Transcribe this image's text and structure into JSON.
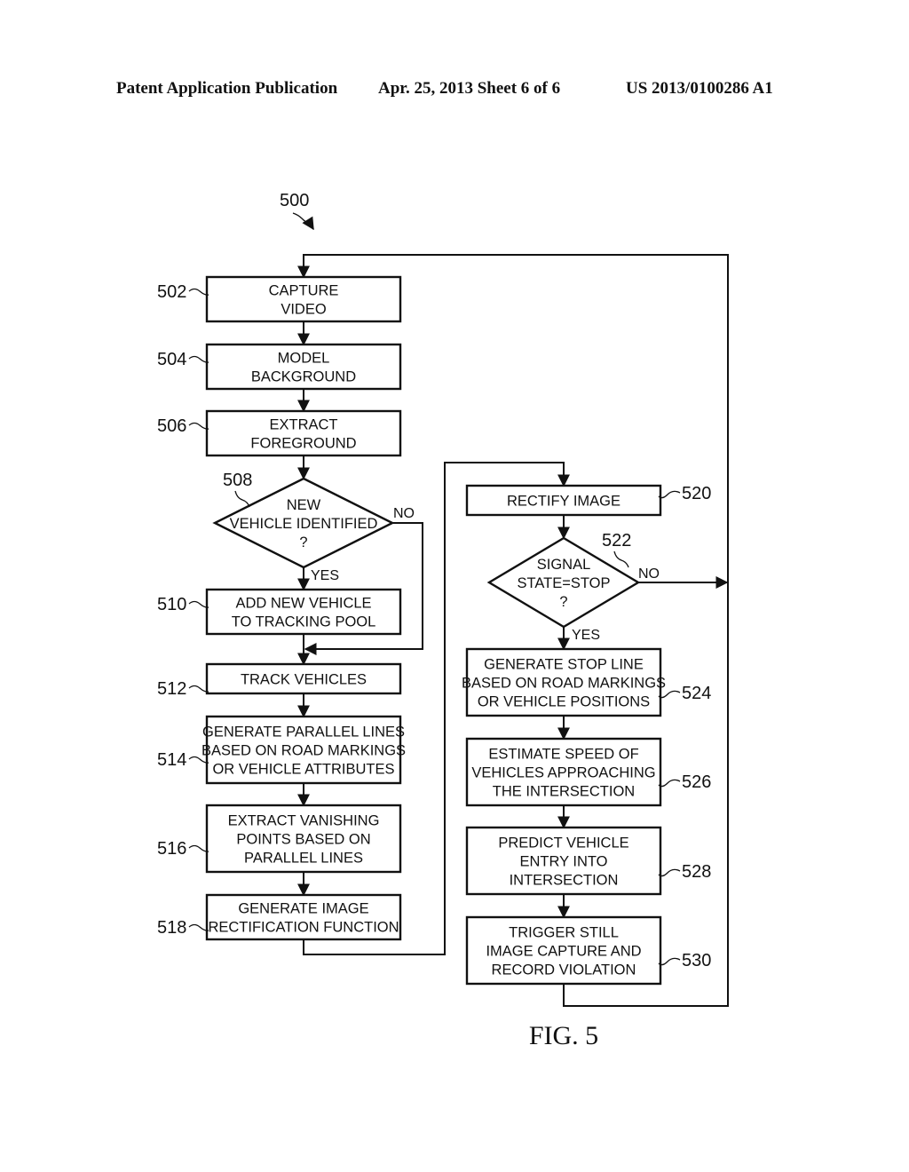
{
  "header": {
    "left": "Patent Application Publication",
    "center": "Apr. 25, 2013  Sheet 6 of 6",
    "right": "US 2013/0100286 A1"
  },
  "diagram": {
    "ref": "500",
    "figure_label": "FIG. 5",
    "steps": [
      {
        "id": "502",
        "shape": "process",
        "lines": [
          "CAPTURE",
          "VIDEO"
        ]
      },
      {
        "id": "504",
        "shape": "process",
        "lines": [
          "MODEL",
          "BACKGROUND"
        ]
      },
      {
        "id": "506",
        "shape": "process",
        "lines": [
          "EXTRACT",
          "FOREGROUND"
        ]
      },
      {
        "id": "508",
        "shape": "decision",
        "lines": [
          "NEW",
          "VEHICLE IDENTIFIED",
          "?"
        ],
        "yes_label": "YES",
        "no_label": "NO"
      },
      {
        "id": "510",
        "shape": "process",
        "lines": [
          "ADD NEW VEHICLE",
          "TO TRACKING POOL"
        ]
      },
      {
        "id": "512",
        "shape": "process",
        "lines": [
          "TRACK VEHICLES"
        ]
      },
      {
        "id": "514",
        "shape": "process",
        "lines": [
          "GENERATE PARALLEL LINES",
          "BASED ON ROAD MARKINGS",
          "OR VEHICLE ATTRIBUTES"
        ]
      },
      {
        "id": "516",
        "shape": "process",
        "lines": [
          "EXTRACT VANISHING",
          "POINTS BASED ON",
          "PARALLEL LINES"
        ]
      },
      {
        "id": "518",
        "shape": "process",
        "lines": [
          "GENERATE IMAGE",
          "RECTIFICATION FUNCTION"
        ]
      },
      {
        "id": "520",
        "shape": "process",
        "lines": [
          "RECTIFY IMAGE"
        ]
      },
      {
        "id": "522",
        "shape": "decision",
        "lines": [
          "SIGNAL",
          "STATE=STOP",
          "?"
        ],
        "yes_label": "YES",
        "no_label": "NO"
      },
      {
        "id": "524",
        "shape": "process",
        "lines": [
          "GENERATE STOP LINE",
          "BASED ON ROAD MARKINGS",
          "OR VEHICLE POSITIONS"
        ]
      },
      {
        "id": "526",
        "shape": "process",
        "lines": [
          "ESTIMATE SPEED OF",
          "VEHICLES APPROACHING",
          "THE INTERSECTION"
        ]
      },
      {
        "id": "528",
        "shape": "process",
        "lines": [
          "PREDICT VEHICLE",
          "ENTRY INTO",
          "INTERSECTION"
        ]
      },
      {
        "id": "530",
        "shape": "process",
        "lines": [
          "TRIGGER STILL",
          "IMAGE CAPTURE AND",
          "RECORD VIOLATION"
        ]
      }
    ],
    "connections": [
      {
        "from": "502",
        "to": "504"
      },
      {
        "from": "504",
        "to": "506"
      },
      {
        "from": "506",
        "to": "508"
      },
      {
        "from": "508",
        "to": "510",
        "label": "YES"
      },
      {
        "from": "508",
        "to": "512",
        "label": "NO"
      },
      {
        "from": "510",
        "to": "512"
      },
      {
        "from": "512",
        "to": "514"
      },
      {
        "from": "514",
        "to": "516"
      },
      {
        "from": "516",
        "to": "518"
      },
      {
        "from": "518",
        "to": "520"
      },
      {
        "from": "520",
        "to": "522"
      },
      {
        "from": "522",
        "to": "524",
        "label": "YES"
      },
      {
        "from": "522",
        "to": "502",
        "label": "NO"
      },
      {
        "from": "524",
        "to": "526"
      },
      {
        "from": "526",
        "to": "528"
      },
      {
        "from": "528",
        "to": "530"
      },
      {
        "from": "530",
        "to": "502"
      }
    ]
  }
}
